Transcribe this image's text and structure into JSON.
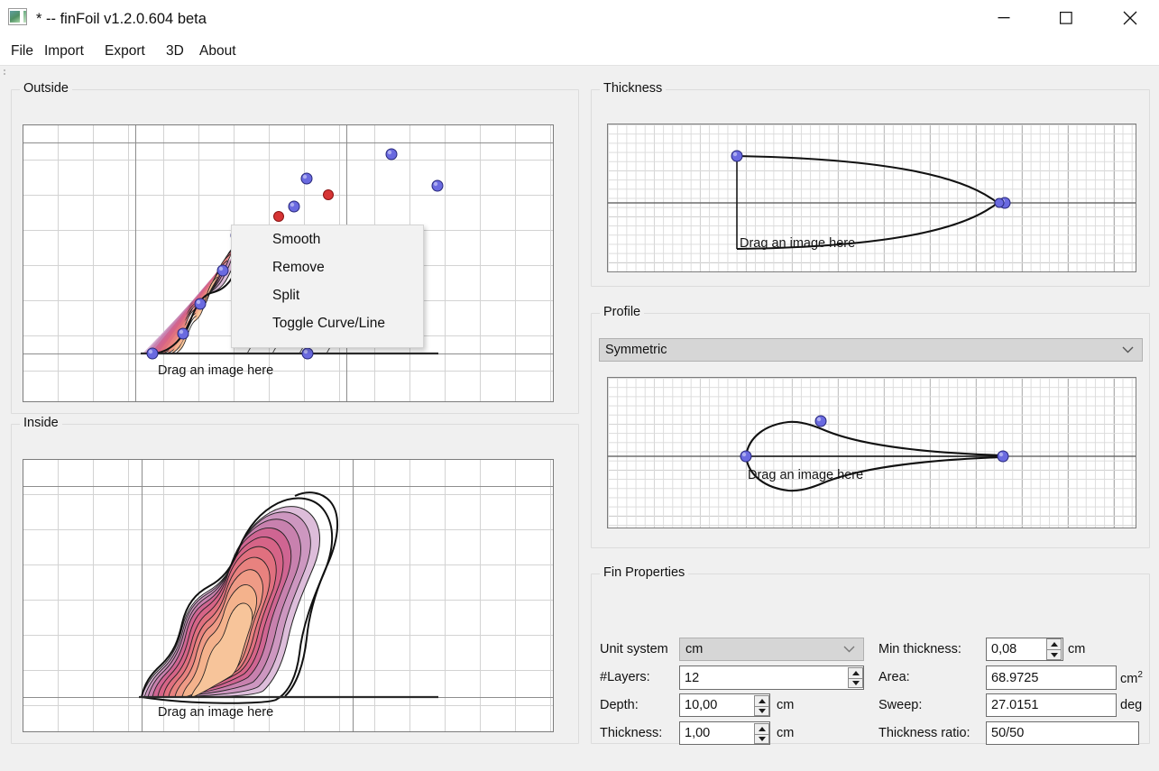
{
  "window": {
    "title": "* -- finFoil v1.2.0.604 beta",
    "icon": "image-picture-icon",
    "controls": {
      "minimize": "minimize-icon",
      "maximize": "maximize-icon",
      "close": "close-icon"
    }
  },
  "menubar": {
    "items": [
      {
        "label": "File"
      },
      {
        "label": "Import"
      },
      {
        "label": "Export"
      },
      {
        "label": "3D"
      },
      {
        "label": "About"
      }
    ]
  },
  "panels": {
    "outside": {
      "title": "Outside",
      "drop_hint": "Drag an image here"
    },
    "inside": {
      "title": "Inside",
      "drop_hint": "Drag an image here"
    },
    "thickness": {
      "title": "Thickness",
      "drop_hint": "Drag an image here"
    },
    "profile": {
      "title": "Profile",
      "drop_hint": "Drag an image here",
      "selected": "Symmetric",
      "options": [
        "Symmetric"
      ]
    }
  },
  "context_menu": {
    "items": [
      {
        "label": "Smooth"
      },
      {
        "label": "Remove"
      },
      {
        "label": "Split"
      },
      {
        "label": "Toggle Curve/Line"
      }
    ]
  },
  "fin_properties": {
    "title": "Fin Properties",
    "unit_system": {
      "label": "Unit system",
      "value": "cm",
      "options": [
        "cm"
      ]
    },
    "layers": {
      "label": "#Layers:",
      "value": "12"
    },
    "depth": {
      "label": "Depth:",
      "value": "10,00",
      "unit": "cm"
    },
    "thickness": {
      "label": "Thickness:",
      "value": "1,00",
      "unit": "cm"
    },
    "min_thickness": {
      "label": "Min thickness:",
      "value": "0,08",
      "unit": "cm"
    },
    "area": {
      "label": "Area:",
      "value": "68.9725",
      "unit": "cm",
      "unit_sup": "2"
    },
    "sweep": {
      "label": "Sweep:",
      "value": "27.0151",
      "unit": "deg"
    },
    "thickness_ratio": {
      "label": "Thickness ratio:",
      "value": "50/50"
    }
  },
  "colors": {
    "layer_1": "#f7c49a",
    "layer_2": "#f4b28c",
    "layer_3": "#ef9b86",
    "layer_4": "#e8827f",
    "layer_5": "#e0707f",
    "layer_6": "#d66487",
    "layer_7": "#cf6592",
    "layer_8": "#c96f9e",
    "layer_9": "#c881ae",
    "layer_10": "#cd97c0",
    "layer_11": "#d6a9cd",
    "layer_12": "#ddbdda",
    "outline": "#111111",
    "control_point": "#5b5bd6",
    "control_point_selected": "#d62222",
    "grid_minor": "#d3d3d3",
    "grid_major": "#8d8d8d"
  }
}
